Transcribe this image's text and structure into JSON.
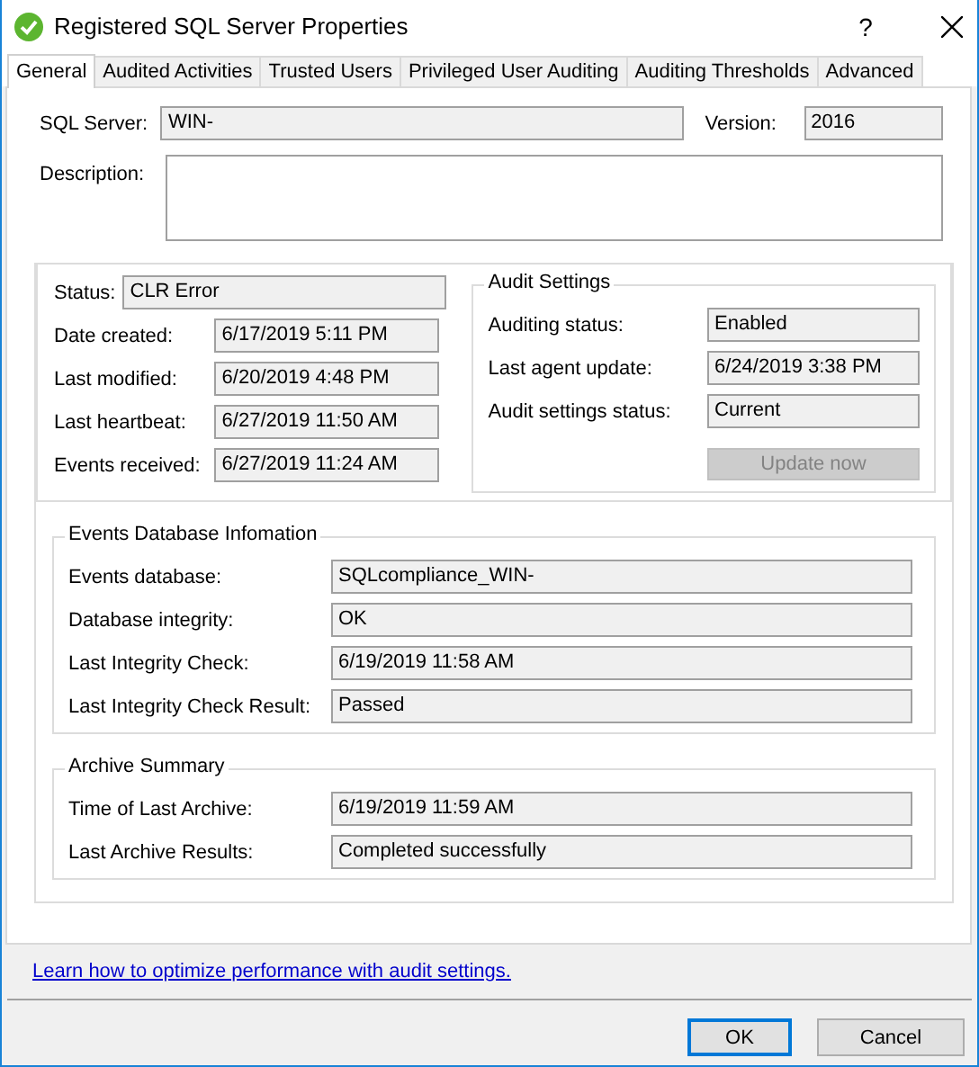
{
  "window": {
    "title": "Registered SQL Server Properties",
    "help": "?"
  },
  "tabs": [
    {
      "label": "General",
      "selected": true
    },
    {
      "label": "Audited Activities",
      "selected": false
    },
    {
      "label": "Trusted Users",
      "selected": false
    },
    {
      "label": "Privileged User Auditing",
      "selected": false
    },
    {
      "label": "Auditing Thresholds",
      "selected": false
    },
    {
      "label": "Advanced",
      "selected": false
    }
  ],
  "server": {
    "label": "SQL Server:",
    "value": "WIN-",
    "version_label": "Version:",
    "version": "2016",
    "description_label": "Description:"
  },
  "status": [
    {
      "label": "Status:",
      "value": "CLR Error"
    },
    {
      "label": "Date created:",
      "value": "6/17/2019 5:11 PM"
    },
    {
      "label": "Last modified:",
      "value": "6/20/2019 4:48 PM"
    },
    {
      "label": "Last heartbeat:",
      "value": "6/27/2019 11:50 AM"
    },
    {
      "label": "Events received:",
      "value": "6/27/2019 11:24 AM"
    }
  ],
  "audit_settings": {
    "title": "Audit Settings",
    "fields": [
      {
        "label": "Auditing status:",
        "value": "Enabled"
      },
      {
        "label": "Last agent update:",
        "value": "6/24/2019 3:38 PM"
      },
      {
        "label": "Audit settings status:",
        "value": "Current"
      }
    ],
    "button": {
      "label": "Update now",
      "disabled": true
    }
  },
  "events_database": {
    "title": "Events Database Infomation",
    "fields": [
      {
        "label": "Events database:",
        "value": "SQLcompliance_WIN-"
      },
      {
        "label": "Database integrity:",
        "value": "OK"
      },
      {
        "label": "Last Integrity Check:",
        "value": "6/19/2019 11:58 AM"
      },
      {
        "label": "Last Integrity Check Result:",
        "value": "Passed"
      }
    ]
  },
  "archive_summary": {
    "title": "Archive Summary",
    "fields": [
      {
        "label": "Time of Last Archive:",
        "value": "6/19/2019 11:59 AM"
      },
      {
        "label": "Last Archive Results:",
        "value": "Completed successfully"
      }
    ]
  },
  "link": "Learn how to optimize performance with audit settings.",
  "buttons": [
    {
      "label": "OK",
      "default": true
    },
    {
      "label": "Cancel",
      "default": false
    }
  ]
}
